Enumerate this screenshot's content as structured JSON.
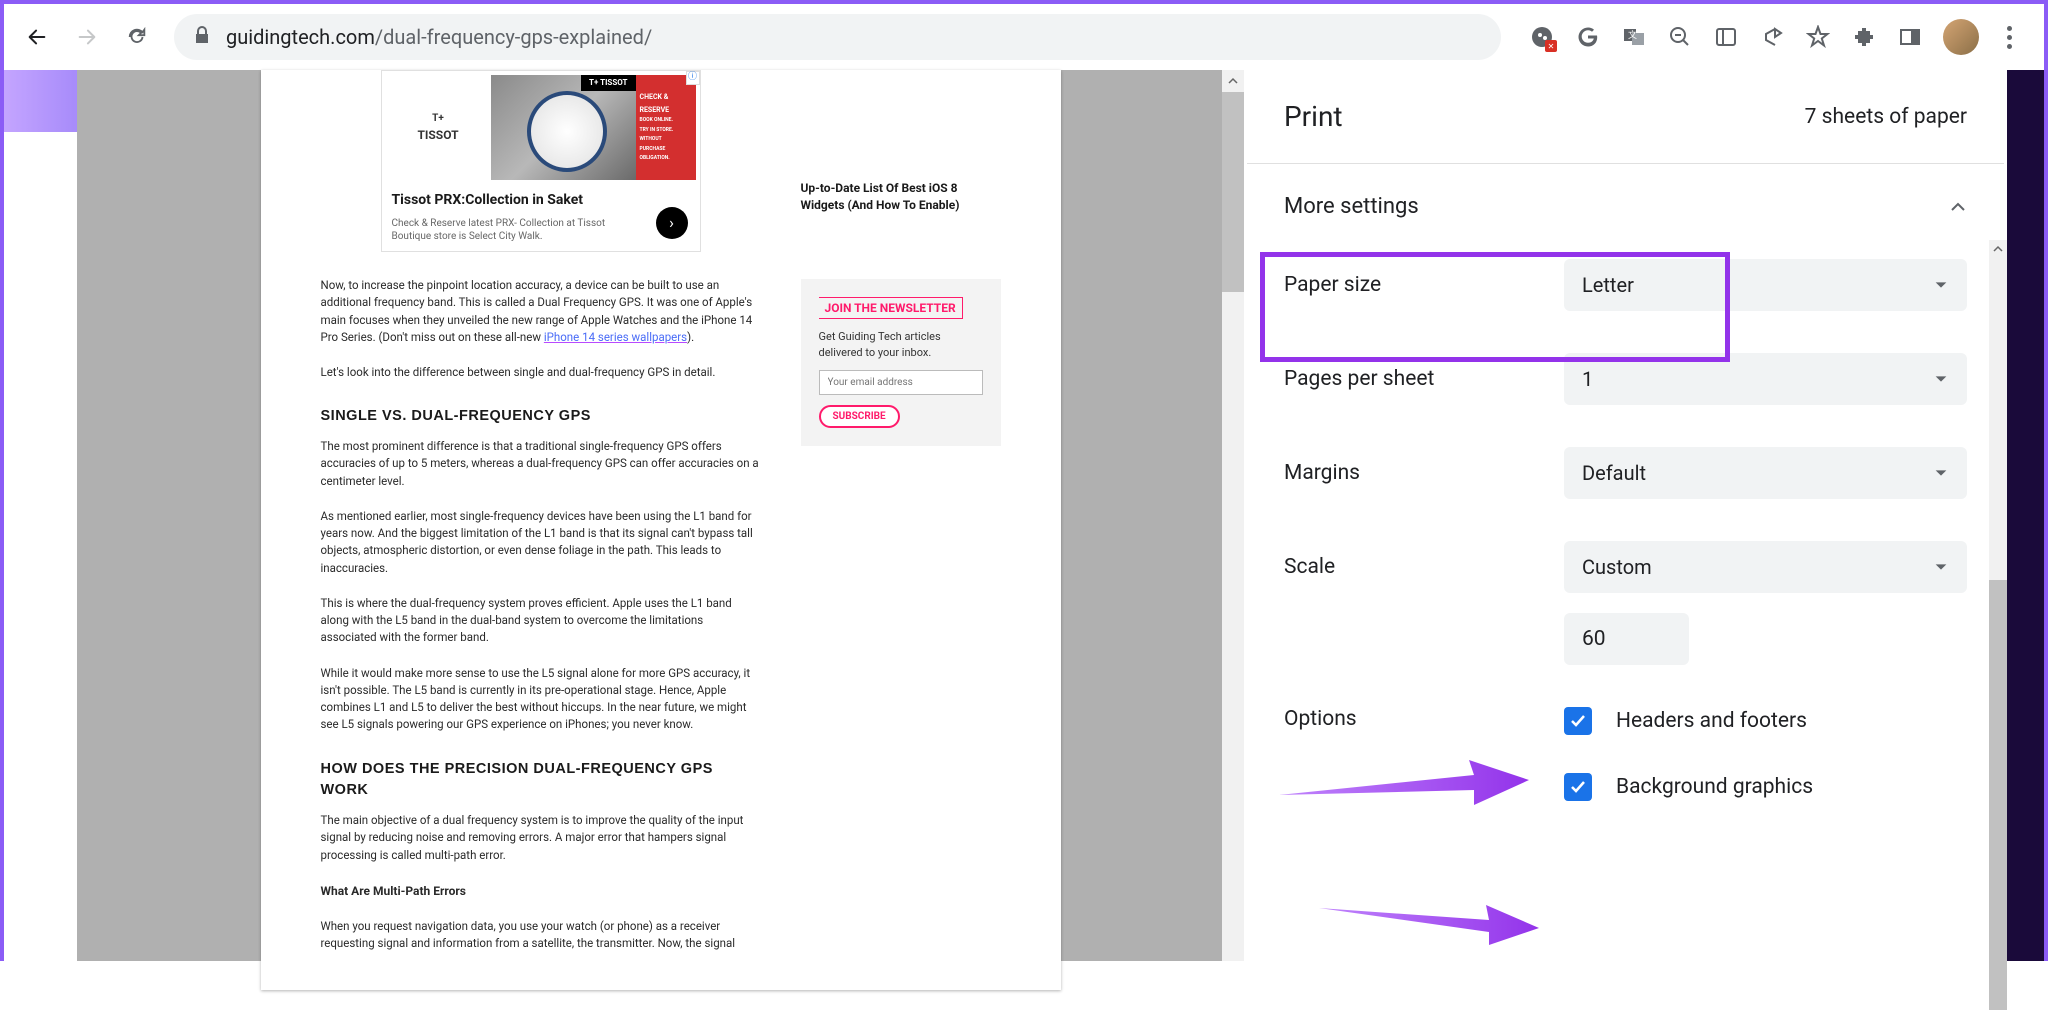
{
  "browser": {
    "url_host": "guidingtech.com",
    "url_path": "/dual-frequency-gps-explained/"
  },
  "article": {
    "ad": {
      "brand_small": "T+",
      "brand": "TISSOT",
      "tissot_bar": "T+ TISSOT",
      "red_lines": [
        "CHECK &",
        "RESERVE",
        "BOOK ONLINE.",
        "TRY IN STORE.",
        "WITHOUT",
        "PURCHASE",
        "OBLIGATION."
      ],
      "title": "Tissot PRX:Collection in Saket",
      "desc": "Check & Reserve latest PRX- Collection at Tissot Boutique store is Select City Walk."
    },
    "side_link": "Up-to-Date List Of Best iOS 8 Widgets (And How To Enable)",
    "p1a": "Now, to increase the pinpoint location accuracy, a device can be built to use an additional frequency band. This is called a Dual Frequency GPS. It was one of Apple's main focuses when they unveiled the new range of Apple Watches and the iPhone 14 Pro Series. (Don't miss out on these all-new ",
    "p1_link": "iPhone 14 series wallpapers",
    "p1b": ").",
    "p2": "Let's look into the difference between single and dual-frequency GPS in detail.",
    "h1": "SINGLE VS. DUAL-FREQUENCY GPS",
    "p3": "The most prominent difference is that a traditional single-frequency GPS offers accuracies of up to 5 meters, whereas a dual-frequency GPS can offer accuracies on a centimeter level.",
    "p4": "As mentioned earlier, most single-frequency devices have been using the L1 band for years now. And the biggest limitation of the L1 band is that its signal can't bypass tall objects, atmospheric distortion, or even dense foliage in the path. This leads to inaccuracies.",
    "p5": "This is where the dual-frequency system proves efficient. Apple uses the L1 band along with the L5 band in the dual-band system to overcome the limitations associated with the former band.",
    "p6": "While it would make more sense to use the L5 signal alone for more GPS accuracy, it isn't possible. The L5 band is currently in its pre-operational stage. Hence, Apple combines L1 and L5 to deliver the best without hiccups. In the near future, we might see L5 signals powering our GPS experience on iPhones; you never know.",
    "h2": "HOW DOES THE PRECISION DUAL-FREQUENCY GPS WORK",
    "p7": "The main objective of a dual frequency system is to improve the quality of the input signal by reducing noise and removing errors. A major error that hampers signal processing is called multi-path error.",
    "h3": "What Are Multi-Path Errors",
    "p8": "When you request navigation data, you use your watch (or phone) as a receiver requesting signal and information from a satellite, the transmitter. Now, the signal",
    "newsletter": {
      "title": "JOIN THE NEWSLETTER",
      "desc": "Get Guiding Tech articles delivered to your inbox.",
      "placeholder": "Your email address",
      "button": "SUBSCRIBE"
    }
  },
  "print": {
    "title": "Print",
    "sheets": "7 sheets of paper",
    "more_settings": "More settings",
    "paper_size": {
      "label": "Paper size",
      "value": "Letter"
    },
    "pages_per_sheet": {
      "label": "Pages per sheet",
      "value": "1"
    },
    "margins": {
      "label": "Margins",
      "value": "Default"
    },
    "scale": {
      "label": "Scale",
      "value": "Custom",
      "number": "60"
    },
    "options_label": "Options",
    "headers_footers": "Headers and footers",
    "background_graphics": "Background graphics"
  }
}
